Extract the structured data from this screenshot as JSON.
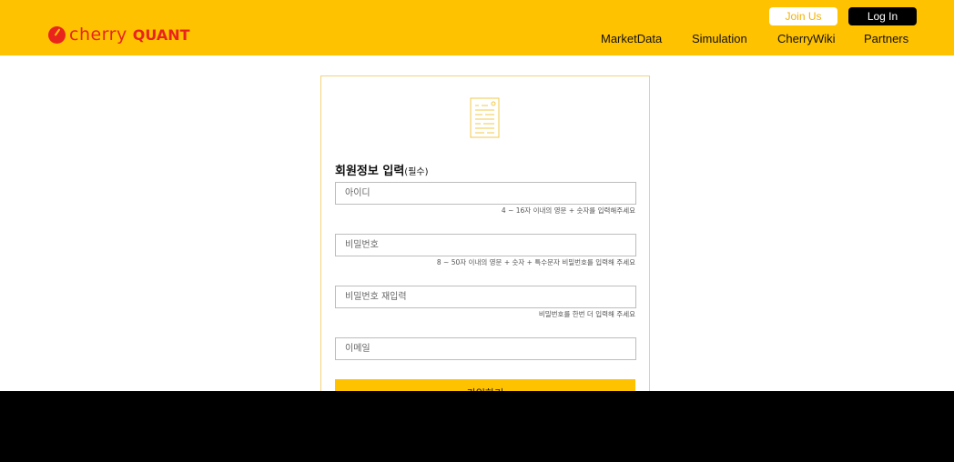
{
  "header": {
    "logo_word": "cherry",
    "logo_brand": "QUANT",
    "join_label": "Join Us",
    "login_label": "Log In",
    "nav": [
      "MarketData",
      "Simulation",
      "CherryWiki",
      "Partners"
    ]
  },
  "form": {
    "title": "회원정보 입력",
    "title_suffix": "(필수)",
    "fields": [
      {
        "placeholder": "아이디",
        "hint": "4 ~ 16자 이내의 영문 + 숫자를 입력해주세요"
      },
      {
        "placeholder": "비밀번호",
        "hint": "8 ~ 50자 이내의 영문 + 숫자 + 특수문자 비밀번호를 입력해 주세요"
      },
      {
        "placeholder": "비밀번호 재입력",
        "hint": "비밀번호를 한번 더 입력해 주세요"
      },
      {
        "placeholder": "이메일",
        "hint": ""
      }
    ],
    "submit_label": "가입하기"
  },
  "colors": {
    "brand_yellow": "#ffc200",
    "logo_red": "#e8241d",
    "card_border": "#f5d27a"
  }
}
